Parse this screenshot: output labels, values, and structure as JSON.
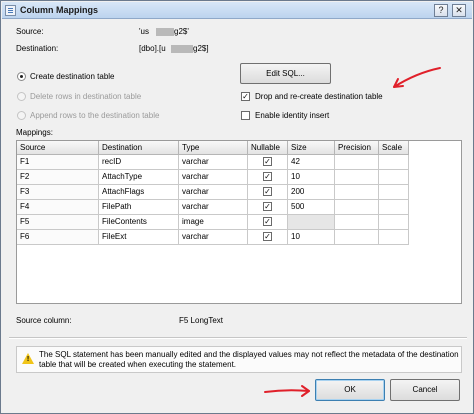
{
  "window": {
    "title": "Column Mappings",
    "controls": {
      "help": "?",
      "close": "✕"
    }
  },
  "source": {
    "label": "Source:",
    "value": "'us",
    "value_end": "g2$'"
  },
  "destination": {
    "label": "Destination:",
    "value": "[dbo].[u",
    "value_end": "g2$]"
  },
  "options": {
    "create_table": "Create destination table",
    "delete_rows": "Delete rows in destination table",
    "append_rows": "Append rows to the destination table",
    "edit_sql": "Edit SQL...",
    "drop_recreate": "Drop and re-create destination table",
    "identity_insert": "Enable identity insert"
  },
  "mappings": {
    "label": "Mappings:",
    "columns": [
      "Source",
      "Destination",
      "Type",
      "Nullable",
      "Size",
      "Precision",
      "Scale"
    ],
    "rows": [
      {
        "source": "F1",
        "destination": "recID",
        "type": "varchar",
        "nullable": "✓",
        "size": "42"
      },
      {
        "source": "F2",
        "destination": "AttachType",
        "type": "varchar",
        "nullable": "✓",
        "size": "10"
      },
      {
        "source": "F3",
        "destination": "AttachFlags",
        "type": "varchar",
        "nullable": "✓",
        "size": "200"
      },
      {
        "source": "F4",
        "destination": "FilePath",
        "type": "varchar",
        "nullable": "✓",
        "size": "500"
      },
      {
        "source": "F5",
        "destination": "FileContents",
        "type": "image",
        "nullable": "✓",
        "size": ""
      },
      {
        "source": "F6",
        "destination": "FileExt",
        "type": "varchar",
        "nullable": "✓",
        "size": "10"
      }
    ]
  },
  "source_column": {
    "label": "Source column:",
    "value": "F5 LongText"
  },
  "warning": "The SQL statement has been manually edited and the displayed values may not reflect the metadata of the destination table that will be created when executing the statement.",
  "buttons": {
    "ok": "OK",
    "cancel": "Cancel"
  },
  "checks": {
    "mark": "✓"
  },
  "colors": {
    "arrow": "#e0202a",
    "title_bar": "#c9dcf2",
    "warning": "#f0c419"
  }
}
